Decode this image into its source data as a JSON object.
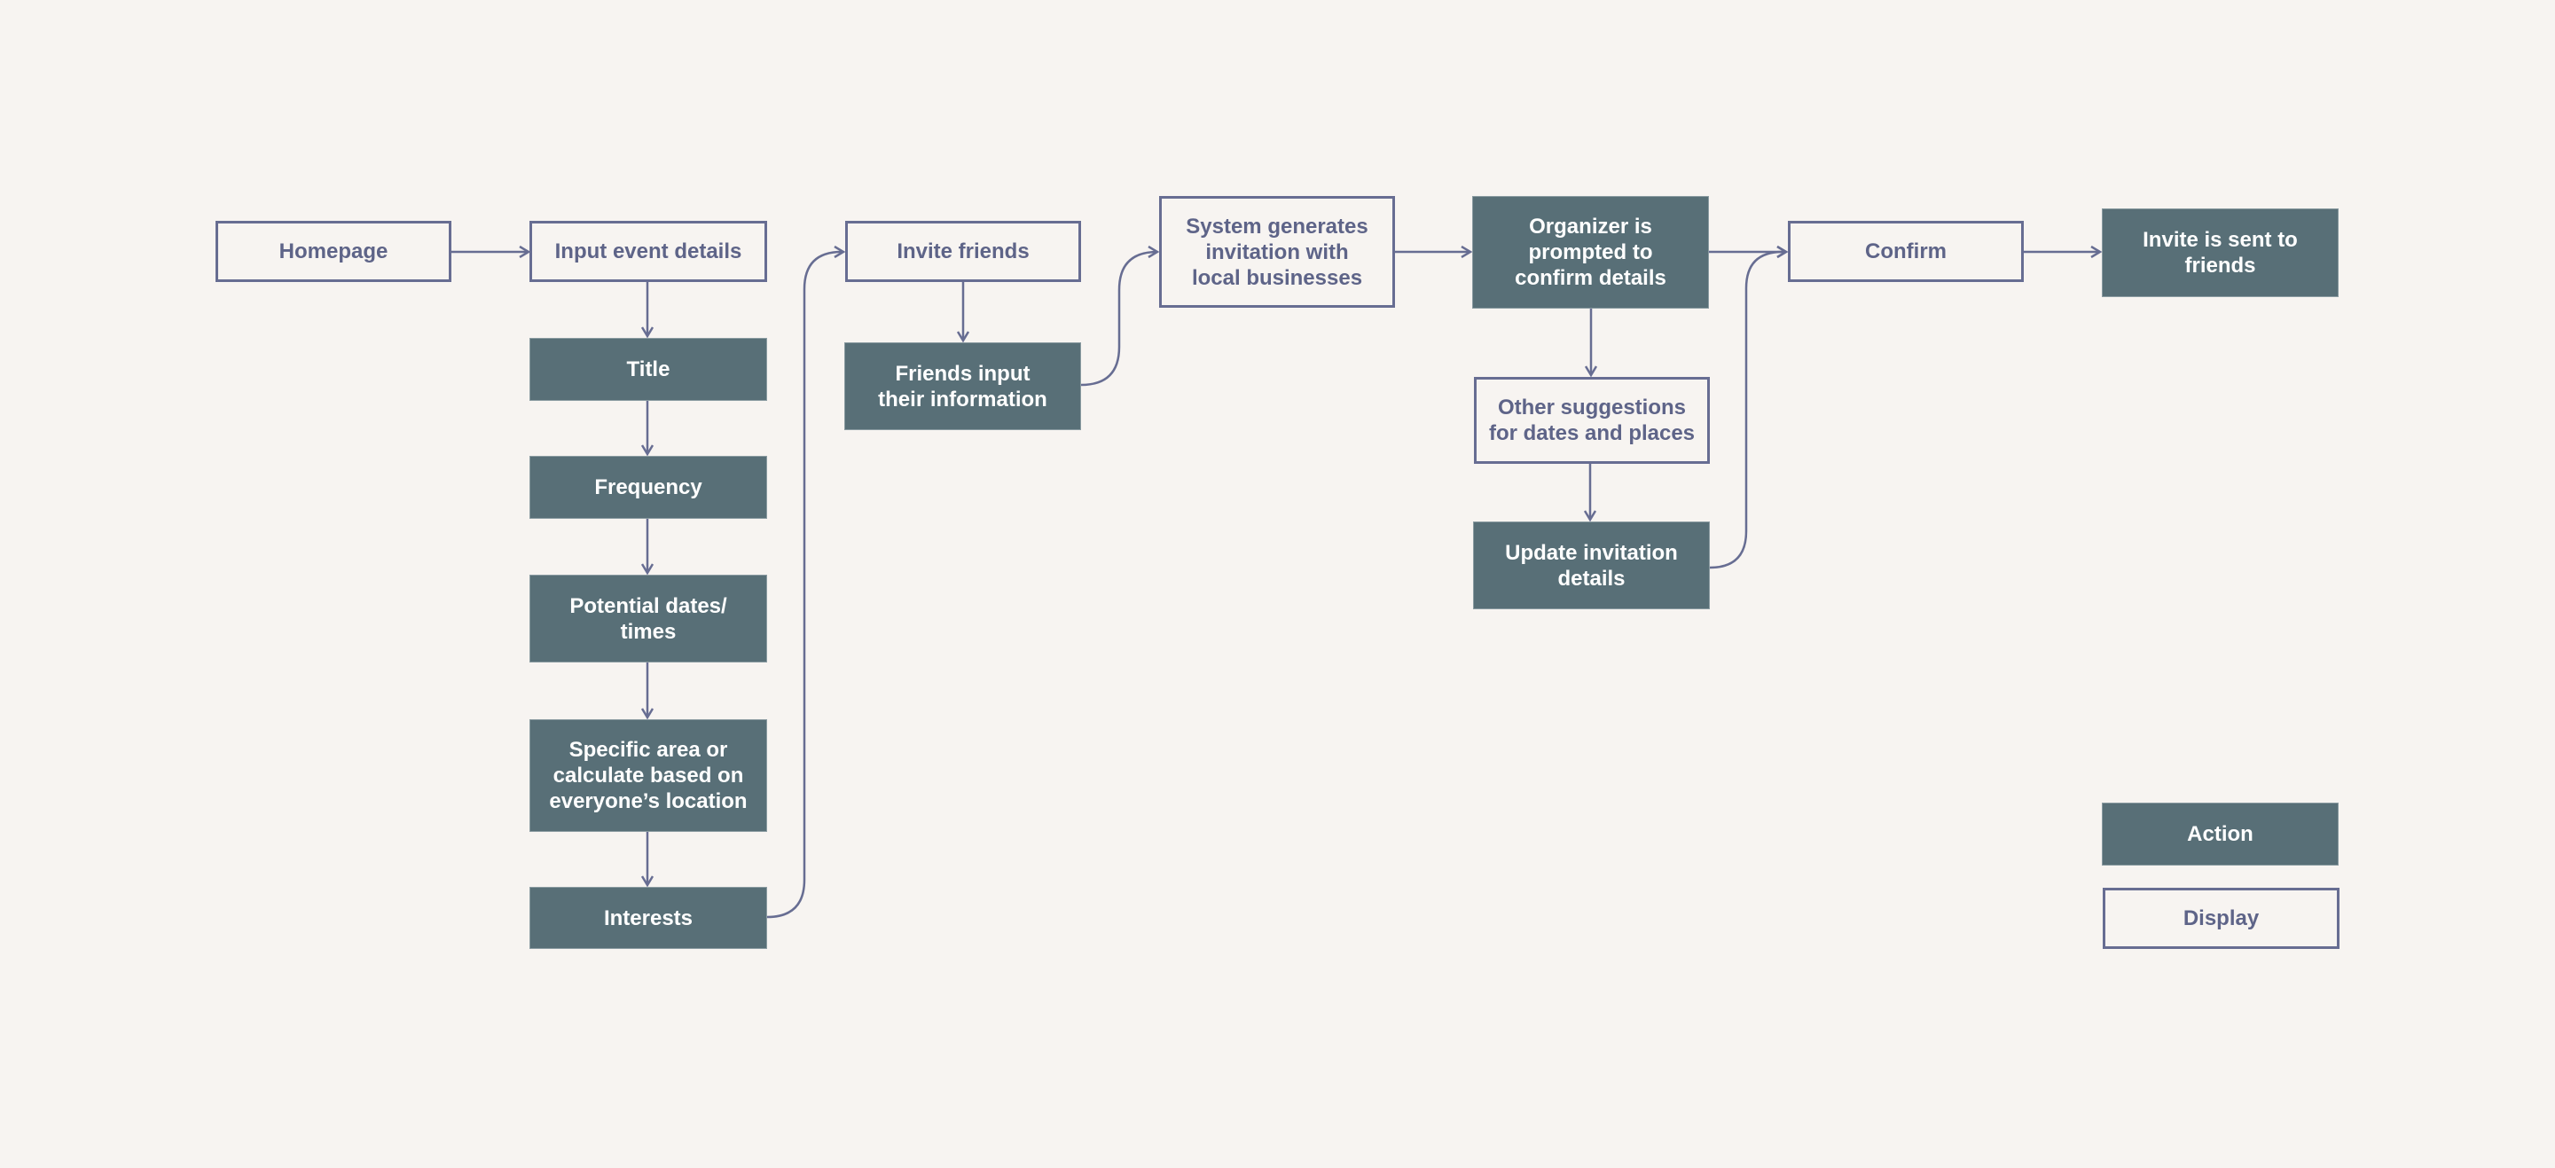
{
  "diagram": {
    "type": "user-flow",
    "colors": {
      "background": "#f7f4f1",
      "action_fill": "#586f77",
      "action_text": "#ffffff",
      "display_stroke": "#676d92",
      "display_text": "#5e6488",
      "connector": "#676d92"
    },
    "nodes": {
      "homepage": {
        "label": "Homepage",
        "kind": "display"
      },
      "input_event_details": {
        "label": "Input event details",
        "kind": "display"
      },
      "title": {
        "label": "Title",
        "kind": "action"
      },
      "frequency": {
        "label": "Frequency",
        "kind": "action"
      },
      "potential_dates": {
        "label": "Potential dates/ times",
        "kind": "action"
      },
      "specific_area": {
        "label": "Specific area or calculate based on everyone’s location",
        "kind": "action"
      },
      "interests": {
        "label": "Interests",
        "kind": "action"
      },
      "invite_friends": {
        "label": "Invite friends",
        "kind": "display"
      },
      "friends_input": {
        "label": "Friends input their information",
        "kind": "action"
      },
      "system_generates": {
        "label": "System generates invitation with local businesses",
        "kind": "display"
      },
      "organizer_prompted": {
        "label": "Organizer is prompted to confirm details",
        "kind": "action"
      },
      "other_suggestions": {
        "label": "Other suggestions for dates and places",
        "kind": "display"
      },
      "update_invitation": {
        "label": "Update invitation details",
        "kind": "action"
      },
      "confirm": {
        "label": "Confirm",
        "kind": "display"
      },
      "invite_sent": {
        "label": "Invite is sent to friends",
        "kind": "action"
      }
    },
    "edges": [
      {
        "from": "homepage",
        "to": "input_event_details"
      },
      {
        "from": "input_event_details",
        "to": "title"
      },
      {
        "from": "title",
        "to": "frequency"
      },
      {
        "from": "frequency",
        "to": "potential_dates"
      },
      {
        "from": "potential_dates",
        "to": "specific_area"
      },
      {
        "from": "specific_area",
        "to": "interests"
      },
      {
        "from": "interests",
        "to": "invite_friends"
      },
      {
        "from": "invite_friends",
        "to": "friends_input"
      },
      {
        "from": "friends_input",
        "to": "system_generates"
      },
      {
        "from": "system_generates",
        "to": "organizer_prompted"
      },
      {
        "from": "organizer_prompted",
        "to": "other_suggestions"
      },
      {
        "from": "other_suggestions",
        "to": "update_invitation"
      },
      {
        "from": "organizer_prompted",
        "to": "confirm"
      },
      {
        "from": "update_invitation",
        "to": "confirm"
      },
      {
        "from": "confirm",
        "to": "invite_sent"
      }
    ],
    "legend": {
      "action": "Action",
      "display": "Display"
    }
  }
}
